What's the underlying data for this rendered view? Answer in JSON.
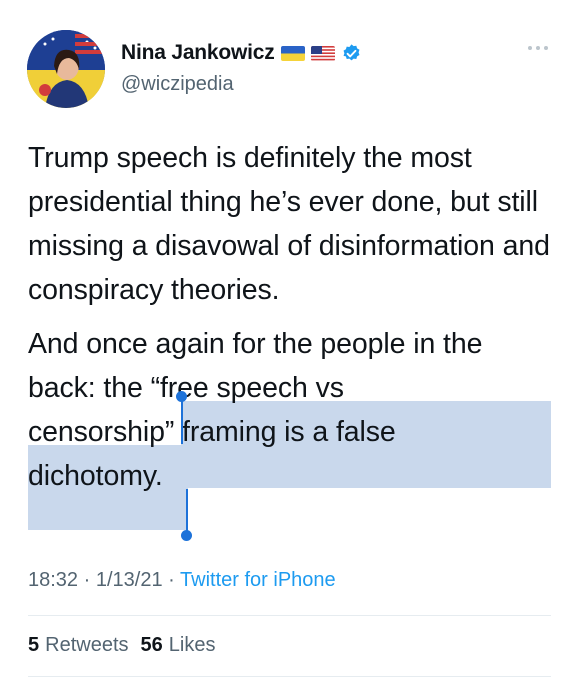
{
  "author": {
    "name": "Nina Jankowicz",
    "handle": "@wiczipedia",
    "flags": [
      "ukraine-flag-icon",
      "us-flag-icon"
    ],
    "verified_color": "#1d9bf0"
  },
  "tweet": {
    "paragraph1": "Trump speech is definitely the most presidential thing he’s ever done, but still missing a disavowal of disinformation and conspiracy theories.",
    "p2_line1": "And once again for the people in the",
    "p2_line2_pre": "back: the ",
    "p2_line2_sel": "“free speech vs",
    "p2_line3_sel": "censorship” framing is a false",
    "p2_line4_sel": "dichotomy."
  },
  "meta": {
    "time": "18:32",
    "date": "1/13/21",
    "source": "Twitter for iPhone",
    "separator": "·"
  },
  "stats": {
    "retweets_count": "5",
    "retweets_label": "Retweets",
    "likes_count": "56",
    "likes_label": "Likes"
  },
  "colors": {
    "accent": "#1d9bf0",
    "selection": "#c9d8ec",
    "selection_handle": "#1d72d9"
  }
}
